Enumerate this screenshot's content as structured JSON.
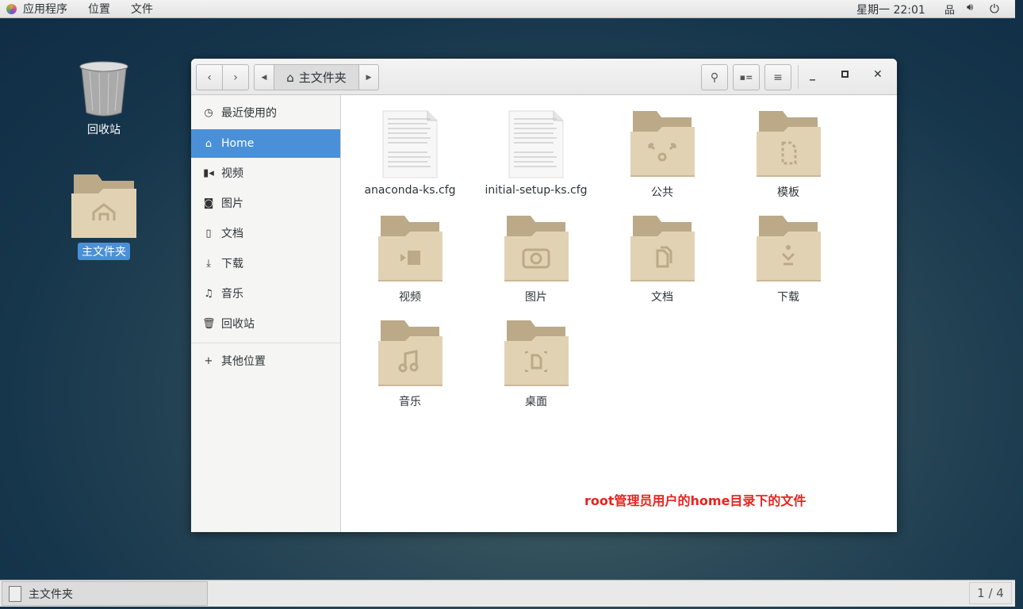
{
  "topbar": {
    "menus": [
      "应用程序",
      "位置",
      "文件"
    ],
    "clock": "星期一 22:01",
    "icons": [
      "network-icon",
      "volume-icon",
      "power-icon"
    ]
  },
  "desktop": {
    "items": [
      {
        "label": "回收站",
        "icon": "trash-icon"
      },
      {
        "label": "主文件夹",
        "icon": "home-folder-icon",
        "selected": true
      }
    ]
  },
  "window": {
    "path": {
      "label": "主文件夹",
      "icon": "home-icon"
    },
    "sidebar": [
      {
        "label": "最近使用的",
        "icon": "clock-icon"
      },
      {
        "label": "Home",
        "icon": "home-icon",
        "selected": true
      },
      {
        "label": "视频",
        "icon": "video-icon"
      },
      {
        "label": "图片",
        "icon": "camera-icon"
      },
      {
        "label": "文档",
        "icon": "document-icon"
      },
      {
        "label": "下载",
        "icon": "download-icon"
      },
      {
        "label": "音乐",
        "icon": "music-icon"
      },
      {
        "label": "回收站",
        "icon": "trash-icon"
      },
      {
        "label": "其他位置",
        "icon": "plus-icon"
      }
    ],
    "files": [
      {
        "name": "anaconda-ks.cfg",
        "type": "text"
      },
      {
        "name": "initial-setup-ks.cfg",
        "type": "text"
      },
      {
        "name": "公共",
        "type": "folder",
        "emblem": "share-icon"
      },
      {
        "name": "模板",
        "type": "folder",
        "emblem": "template-icon"
      },
      {
        "name": "视频",
        "type": "folder",
        "emblem": "video-icon"
      },
      {
        "name": "图片",
        "type": "folder",
        "emblem": "camera-icon"
      },
      {
        "name": "文档",
        "type": "folder",
        "emblem": "document-icon"
      },
      {
        "name": "下载",
        "type": "folder",
        "emblem": "download-icon"
      },
      {
        "name": "音乐",
        "type": "folder",
        "emblem": "music-icon"
      },
      {
        "name": "桌面",
        "type": "folder",
        "emblem": "desktop-icon"
      }
    ],
    "annotation": "root管理员用户的home目录下的文件"
  },
  "taskbar": {
    "task": "主文件夹",
    "workspace": "1 / 4"
  },
  "colors": {
    "accent": "#4a90d9",
    "annotation": "#e8231f",
    "folder": "#e2d2b4"
  }
}
